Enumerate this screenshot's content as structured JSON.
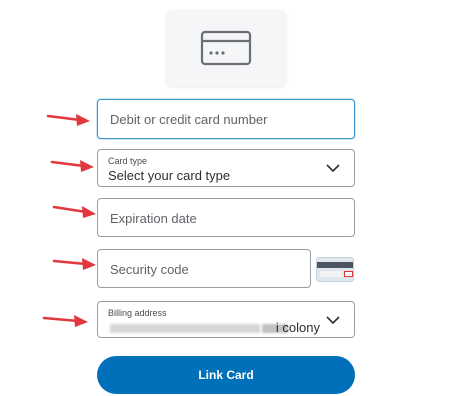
{
  "form": {
    "card_number": {
      "placeholder": "Debit or credit card number"
    },
    "card_type": {
      "label": "Card type",
      "value": "Select your card type"
    },
    "expiration": {
      "placeholder": "Expiration date"
    },
    "security_code": {
      "placeholder": "Security code"
    },
    "billing_address": {
      "label": "Billing address",
      "value_visible": "i colony"
    },
    "submit_label": "Link Card"
  },
  "icons": {
    "card_tile": "credit-card-icon",
    "cvv_hint": "card-back-cvv-icon",
    "chevron": "chevron-down-icon",
    "annotation": "red-arrow-icon"
  },
  "colors": {
    "primary_button": "#0070ba",
    "focus_border": "#3d97c9",
    "annotation_arrow": "#e0383e"
  }
}
